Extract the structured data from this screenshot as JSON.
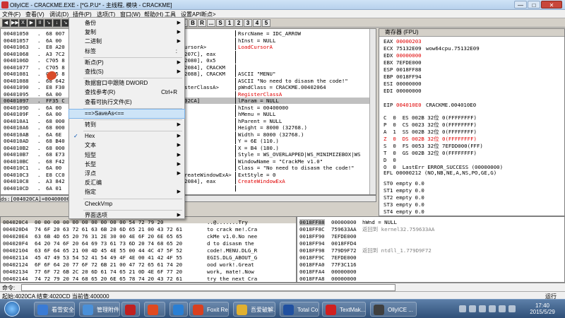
{
  "window": {
    "title": "OllyICE - CRACKME.EXE - [*G.P.U* - 主线程, 模块 - CRACKME]",
    "btn_min": "—",
    "btn_max": "□",
    "btn_close": "✕"
  },
  "menubar": [
    "文件(F)",
    "查看(V)",
    "调试(D)",
    "插件(P)",
    "选项(T)",
    "窗口(W)",
    "帮助(H)",
    "工具",
    "设置API断点>"
  ],
  "toolbar": {
    "buttons": [
      "◀",
      "▶▶",
      "X",
      "▶",
      "II",
      "↘",
      "↓",
      "↘",
      "↘",
      "→",
      "↓"
    ],
    "letters": [
      "L",
      "E",
      "M",
      "T",
      "W",
      "H",
      "C",
      "/",
      "K",
      "B",
      "R",
      "...",
      "S",
      "1",
      "2",
      "3",
      "4",
      "5"
    ]
  },
  "cpu": {
    "rows": [
      [
        "00401050",
        ".",
        "68 007",
        ""
      ],
      [
        "00401057",
        ".",
        "6A 00",
        ""
      ],
      [
        "00401063",
        ".",
        "E8 A20",
        "ursorA>"
      ],
      [
        "00401068",
        ".",
        "A3 7C2",
        "207C], eax"
      ],
      [
        "0040106D",
        ".",
        "C705 8",
        "2080], 0x5"
      ],
      [
        "00401077",
        ".",
        "C705 8",
        "2084], CRACKM"
      ],
      [
        "00401081",
        ".",
        "C705 8",
        "2088], CRACKM"
      ],
      [
        "00401088",
        ".",
        "68 642",
        ""
      ],
      [
        "00401090",
        ".",
        "E8 F30",
        "sterClassA>"
      ],
      [
        "00401095",
        ".",
        "6A 00",
        ""
      ],
      [
        "00401097",
        ".",
        "FF35 C",
        "02CA]"
      ],
      [
        "0040109D",
        ".",
        "6A 00",
        ""
      ],
      [
        "0040109F",
        ".",
        "6A 00",
        ""
      ],
      [
        "004010A1",
        ".",
        "68 000",
        ""
      ],
      [
        "004010A6",
        ".",
        "68 000",
        ""
      ],
      [
        "004010AB",
        ".",
        "6A 6E",
        ""
      ],
      [
        "004010AD",
        ".",
        "68 B40",
        ""
      ],
      [
        "004010B2",
        ".",
        "68 000",
        ""
      ],
      [
        "004010B7",
        ".",
        "68 E73",
        ""
      ],
      [
        "004010BC",
        ".",
        "68 F42",
        ""
      ],
      [
        "004010C1",
        ".",
        "6A 00",
        ""
      ],
      [
        "004010C3",
        ".",
        "E8 CC0",
        "reateWindowExA>"
      ],
      [
        "004010C8",
        ".",
        "A3 842",
        "2084], eax"
      ],
      [
        "004010CD",
        ".",
        "6A 01",
        ""
      ]
    ],
    "comments": [
      {
        "t": "RsrcName = IDC_ARROW",
        "red": false
      },
      {
        "t": "hInst = NULL",
        "red": false
      },
      {
        "t": "LoadCursorA",
        "red": true
      },
      {
        "t": "",
        "red": false
      },
      {
        "t": "",
        "red": false
      },
      {
        "t": "",
        "red": false
      },
      {
        "t": "ASCII \"MENU\"",
        "red": false
      },
      {
        "t": "ASCII \"No need to disasm the code!\"",
        "red": false
      },
      {
        "t": "pWndClass = CRACKME.00402064",
        "red": false
      },
      {
        "t": "RegisterClassA",
        "red": true
      },
      {
        "t": "lParam = NULL",
        "red": false
      },
      {
        "t": "hInst = 00400000",
        "red": false
      },
      {
        "t": "hMenu = NULL",
        "red": false
      },
      {
        "t": "hParent = NULL",
        "red": false
      },
      {
        "t": "Height = 8000 (32768.)",
        "red": false
      },
      {
        "t": "Width = 8000 (32768.)",
        "red": false
      },
      {
        "t": "Y = 6E (110.)",
        "red": false
      },
      {
        "t": "X = B4 (180.)",
        "red": false
      },
      {
        "t": "Style = WS_OVERLAPPED|WS_MINIMIZEBOX|WS",
        "red": false
      },
      {
        "t": "WindowName = \"CrackMe v1.0\"",
        "red": false
      },
      {
        "t": "Class = \"No need to disasm the code!\"",
        "red": false
      },
      {
        "t": "ExtStyle = 0",
        "red": false
      },
      {
        "t": "CreateWindowExA",
        "red": true
      },
      {
        "t": "",
        "red": false
      }
    ],
    "info": "ds:[004020CA]=00400000"
  },
  "context_menu": {
    "items": [
      {
        "label": "备份",
        "arrow": "▶",
        "shortcut": ""
      },
      {
        "label": "复制",
        "arrow": "▶",
        "shortcut": ""
      },
      {
        "label": "二进制",
        "arrow": "▶",
        "shortcut": ""
      },
      {
        "label": "标签",
        "arrow": "",
        "shortcut": ":"
      },
      {
        "label": "断点(P)",
        "arrow": "▶",
        "shortcut": ""
      },
      {
        "label": "查找(S)",
        "arrow": "▶",
        "shortcut": ""
      },
      {
        "label": "数据窗口中跟随 DWORD",
        "arrow": "",
        "shortcut": ""
      },
      {
        "label": "查找参考(R)",
        "arrow": "",
        "shortcut": "Ctrl+R"
      },
      {
        "label": "查看可执行文件(E)",
        "arrow": "",
        "shortcut": ""
      },
      {
        "label": "==>SaveAs<==",
        "arrow": "",
        "shortcut": ""
      },
      {
        "label": "转到",
        "arrow": "▶",
        "shortcut": ""
      },
      {
        "label": "Hex",
        "arrow": "▶",
        "shortcut": ""
      },
      {
        "label": "文本",
        "arrow": "▶",
        "shortcut": ""
      },
      {
        "label": "短型",
        "arrow": "▶",
        "shortcut": ""
      },
      {
        "label": "长型",
        "arrow": "▶",
        "shortcut": ""
      },
      {
        "label": "浮点",
        "arrow": "▶",
        "shortcut": ""
      },
      {
        "label": "反汇编",
        "arrow": "",
        "shortcut": ""
      },
      {
        "label": "指定",
        "arrow": "▶",
        "shortcut": ""
      },
      {
        "label": "CheckVmp",
        "arrow": "",
        "shortcut": ""
      },
      {
        "label": "界面选项",
        "arrow": "▶",
        "shortcut": ""
      }
    ],
    "checked": "✓"
  },
  "registers": {
    "header": "寄存器 (FPU)",
    "rows": [
      {
        "n": "EAX",
        "v": "00000203",
        "c": "",
        "red": true
      },
      {
        "n": "ECX",
        "v": "75132E09",
        "c": "wow64cpu.75132E09",
        "red": false
      },
      {
        "n": "EDX",
        "v": "00000000",
        "c": "",
        "red": true
      },
      {
        "n": "EBX",
        "v": "7EFDE000",
        "c": "",
        "red": false
      },
      {
        "n": "ESP",
        "v": "0018FF88",
        "c": "",
        "red": false
      },
      {
        "n": "EBP",
        "v": "0018FF94",
        "c": "",
        "red": false
      },
      {
        "n": "ESI",
        "v": "00000000",
        "c": "",
        "red": false
      },
      {
        "n": "EDI",
        "v": "00000000",
        "c": "",
        "red": false
      },
      {
        "n": "",
        "v": "",
        "c": "",
        "red": false
      },
      {
        "n": "EIP",
        "v": "004010E0",
        "c": "CRACKME.004010E0",
        "red": true
      }
    ],
    "flags": [
      "C  0  ES 002B 32位 0(FFFFFFFF)",
      "P  0  CS 0023 32位 0(FFFFFFFF)",
      "A  1  SS 002B 32位 0(FFFFFFFF)",
      "Z  0  DS 002B 32位 0(FFFFFFFF)",
      "S  0  FS 0053 32位 7EFDD000(FFF)",
      "T  0  GS 002B 32位 0(FFFFFFFF)",
      "D  0",
      "O  0  LastErr ERROR_SUCCESS (00000000)"
    ],
    "efl": "EFL 00000212 (NO,NB,NE,A,NS,PO,GE,G)",
    "fpu": [
      "ST0 empty 0.0",
      "ST1 empty 0.0",
      "ST2 empty 0.0",
      "ST3 empty 0.0",
      "ST4 empty 0.0",
      "ST5 empty 0.0"
    ]
  },
  "dump": {
    "header": "地址   HEX 数据                                            ASCII",
    "rows": [
      [
        "004020C4",
        "00 00 00 00 00 00 00 00 00 00 54 72 79 20",
        "..@.......Try "
      ],
      [
        "004020D4",
        "74 6F 20 63 72 61 63 6B 20 6D 65 21 00 43 72 61",
        "to crack me!.Cra"
      ],
      [
        "004020E4",
        "63 6B 4D 65 20 76 31 2E 30 00 4E 6F 20 6E 65 65",
        "ckMe v1.0.No nee"
      ],
      [
        "004020F4",
        "64 20 74 6F 20 64 69 73 61 73 6D 20 74 68 65 20",
        "d to disasm the "
      ],
      [
        "00402104",
        "63 6F 64 65 21 00 4D 45 4E 55 00 44 4C 47 5F 52",
        "code!.MENU.DLG_R"
      ],
      [
        "00402114",
        "45 47 49 53 54 52 41 54 49 4F 4E 00 41 42 4F 55",
        "EGIS.DLG_ABOUT_G"
      ],
      [
        "00402124",
        "6F 6F 64 20 77 6F 72 6B 21 00 47 72 65 61 74 20",
        "ood work!.Great "
      ],
      [
        "00402134",
        "77 6F 72 6B 2C 20 6D 61 74 65 21 0D 4E 6F 77 20",
        "work, mate!.Now "
      ],
      [
        "00402144",
        "74 72 79 20 74 68 65 20 6E 65 78 74 20 43 72 61",
        "try the next Cra"
      ]
    ]
  },
  "stack": {
    "rows": [
      [
        "0018FF88",
        "00000000",
        "hWnd = NULL",
        true
      ],
      [
        "0018FF8C",
        "759633AA",
        "返回到 kernel32.759633AA",
        false
      ],
      [
        "0018FF90",
        "7EFDE000",
        "",
        false
      ],
      [
        "0018FF94",
        "0018FFD4",
        "",
        false
      ],
      [
        "0018FF98",
        "779D9F72",
        "返回到 ntdll_1.779D9F72",
        false
      ],
      [
        "0018FF9C",
        "7EFDE000",
        "",
        false
      ],
      [
        "0018FFA0",
        "77F3C116",
        "",
        false
      ],
      [
        "0018FFA4",
        "00000000",
        "",
        false
      ],
      [
        "0018FFA8",
        "00000000",
        "",
        false
      ],
      [
        "0018FFAC",
        "7EFDE000",
        "",
        false
      ]
    ]
  },
  "command": {
    "label": "命令:",
    "value": ""
  },
  "status": {
    "text": "起始:4020CA 结束:4020CD 当前值:400000",
    "right": "运行"
  },
  "taskbar": {
    "items": [
      {
        "label": "看雪安全...",
        "color": "#3a7bd5"
      },
      {
        "label": "管理附件...",
        "color": "#4a90d9"
      },
      {
        "label": "",
        "color": "#c02020"
      },
      {
        "label": "",
        "color": "#e04a20"
      },
      {
        "label": "",
        "color": "#2a7fd4"
      },
      {
        "label": "Foxit Re...",
        "color": "#d94020"
      },
      {
        "label": "吾爱破解...",
        "color": "#e0b030"
      },
      {
        "label": "Total Co...",
        "color": "#2050a0"
      },
      {
        "label": "TextMak...",
        "color": "#d02020"
      },
      {
        "label": "OllyICE ...",
        "color": "#404040"
      }
    ],
    "clock_time": "17:40",
    "clock_date": "2015/5/29"
  }
}
